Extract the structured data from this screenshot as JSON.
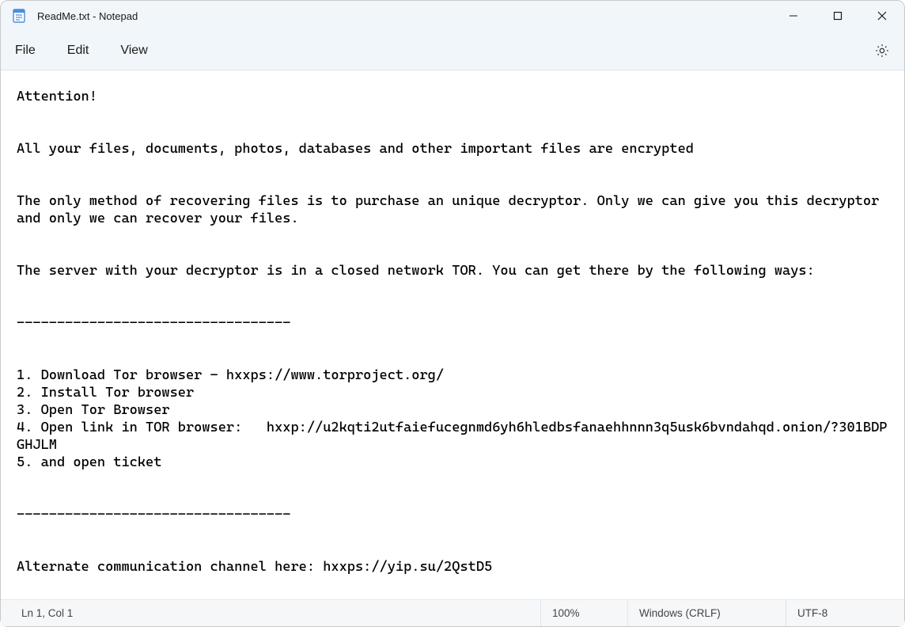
{
  "titlebar": {
    "title": "ReadMe.txt - Notepad"
  },
  "menubar": {
    "file": "File",
    "edit": "Edit",
    "view": "View"
  },
  "content": {
    "text": "Attention!\n\n\nAll your files, documents, photos, databases and other important files are encrypted\n\n\nThe only method of recovering files is to purchase an unique decryptor. Only we can give you this decryptor and only we can recover your files.\n\n\nThe server with your decryptor is in a closed network TOR. You can get there by the following ways:\n\n\n----------------------------------\n\n\n1. Download Tor browser - hxxps://www.torproject.org/\n2. Install Tor browser\n3. Open Tor Browser\n4. Open link in TOR browser:   hxxp://u2kqti2utfaiefucegnmd6yh6hledbsfanaehhnnn3q5usk6bvndahqd.onion/?301BDPGHJLM\n5. and open ticket\n\n\n----------------------------------\n\n\nAlternate communication channel here: hxxps://yip.su/2QstD5"
  },
  "statusbar": {
    "position": "Ln 1, Col 1",
    "zoom": "100%",
    "eol": "Windows (CRLF)",
    "encoding": "UTF-8"
  }
}
